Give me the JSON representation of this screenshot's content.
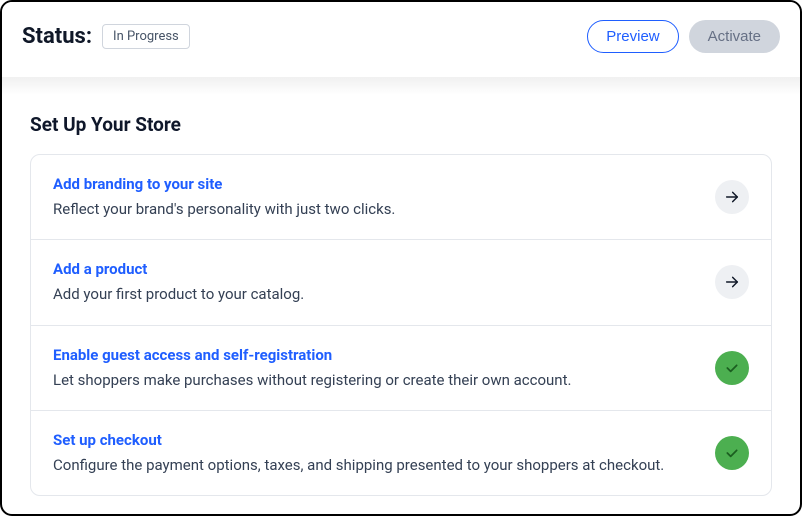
{
  "header": {
    "status_label": "Status:",
    "status_value": "In Progress",
    "preview_label": "Preview",
    "activate_label": "Activate"
  },
  "section": {
    "title": "Set Up Your Store",
    "rows": [
      {
        "title": "Add branding to your site",
        "desc": "Reflect your brand's personality with just two clicks.",
        "state": "pending"
      },
      {
        "title": "Add a product",
        "desc": "Add your first product to your catalog.",
        "state": "pending"
      },
      {
        "title": "Enable guest access and self-registration",
        "desc": "Let shoppers make purchases without registering or create their own account.",
        "state": "done"
      },
      {
        "title": "Set up checkout",
        "desc": "Configure the payment options, taxes, and shipping presented to your shoppers at checkout.",
        "state": "done"
      }
    ]
  },
  "colors": {
    "link": "#1f5eff",
    "success": "#4caf50"
  }
}
